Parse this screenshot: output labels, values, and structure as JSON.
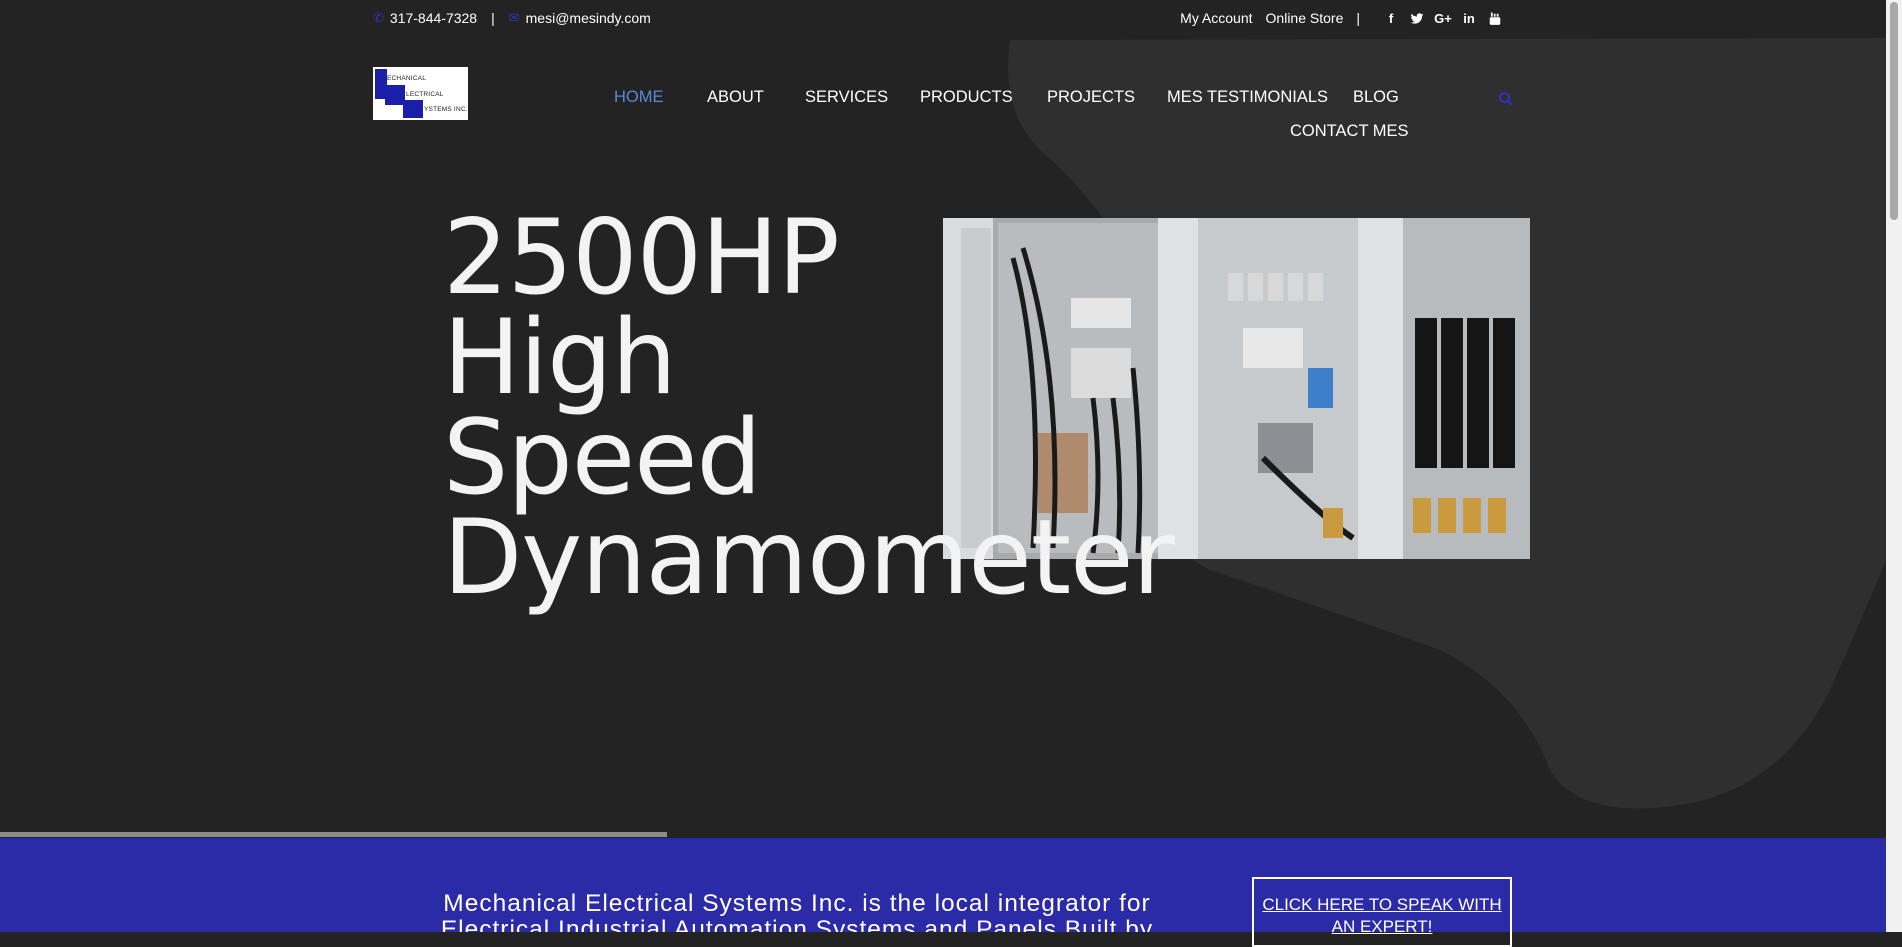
{
  "topbar": {
    "phone": "317-844-7328",
    "divider": "|",
    "email": "mesi@mesindy.com",
    "links": [
      "My Account",
      "Online Store"
    ],
    "social_icons": [
      "facebook-icon",
      "twitter-icon",
      "google-plus-icon",
      "linkedin-icon",
      "youtube-icon"
    ],
    "social_glyphs": {
      "facebook": "f",
      "google_plus": "G+",
      "linkedin": "in"
    }
  },
  "logo": {
    "lines": [
      "ECHANICAL",
      "LECTRICAL",
      "YSTEMS INC."
    ],
    "mark_color": "#1b1fa8"
  },
  "nav": {
    "items": [
      "HOME",
      "ABOUT",
      "SERVICES",
      "PRODUCTS",
      "PROJECTS",
      "MES TESTIMONIALS",
      "BLOG",
      "CONTACT MES"
    ],
    "active": "HOME",
    "active_color": "#5a89d8"
  },
  "hero": {
    "title_lines": [
      "2500HP",
      "High",
      "Speed",
      "Dynamometer"
    ],
    "image_alt": "electrical control panels"
  },
  "band": {
    "tagline": "Mechanical Electrical Systems Inc. is the local integrator for Electrical Industrial Automation Systems and Panels Built by",
    "cta": "CLICK HERE TO SPEAK WITH AN EXPERT!",
    "background": "#2c2ba7"
  },
  "colors": {
    "page_bg": "#232323",
    "accent_blue": "#2e33c4"
  }
}
